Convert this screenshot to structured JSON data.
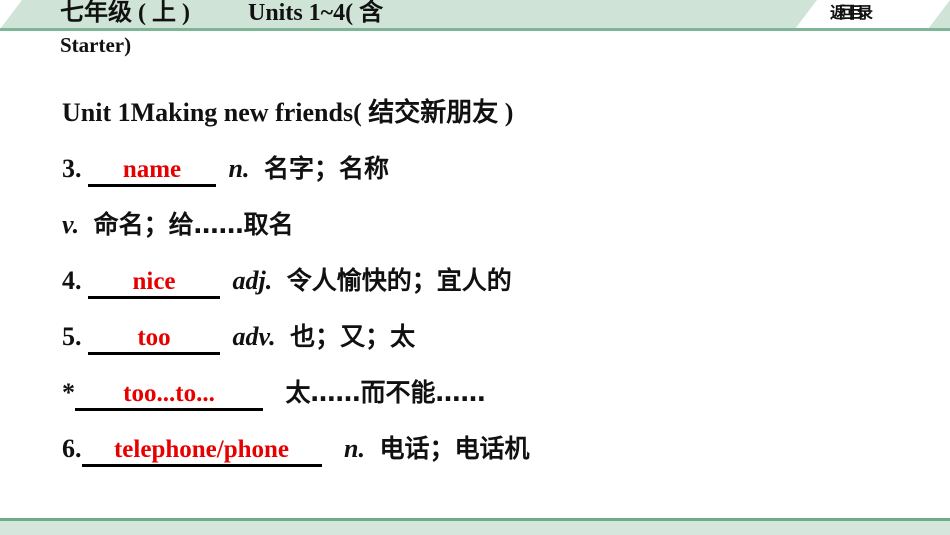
{
  "header": {
    "grade": "七年级 ( 上 )",
    "units": "Units 1~4( 含",
    "units_cont": "Starter)",
    "back_button": "返回目录",
    "band_color": "#cfe4d7",
    "rule_color": "#7fb597"
  },
  "unit": {
    "label": "Unit 1",
    "title": "Making new friends( 结交新朋友 )"
  },
  "entries": [
    {
      "number": "3.",
      "answer": "name",
      "pos": "n.",
      "meaning": "名字；名称"
    },
    {
      "number": "",
      "answer": "",
      "pos": "v.",
      "meaning": "命名；给……取名"
    },
    {
      "number": "4.",
      "answer": "nice",
      "pos": "adj.",
      "meaning": "令人愉快的；宜人的"
    },
    {
      "number": "5.",
      "answer": "too",
      "pos": "adv.",
      "meaning": "也；又；太"
    },
    {
      "number": "*",
      "answer": "too...to...",
      "pos": "",
      "meaning": "太……而不能……"
    },
    {
      "number": "6.",
      "answer": "telephone/phone",
      "pos": "n.",
      "meaning": "电话；电话机"
    }
  ],
  "colors": {
    "answer_red": "#e60000",
    "text_black": "#111111",
    "footer_bg": "#d5e7dc",
    "footer_border": "#6fac88"
  }
}
